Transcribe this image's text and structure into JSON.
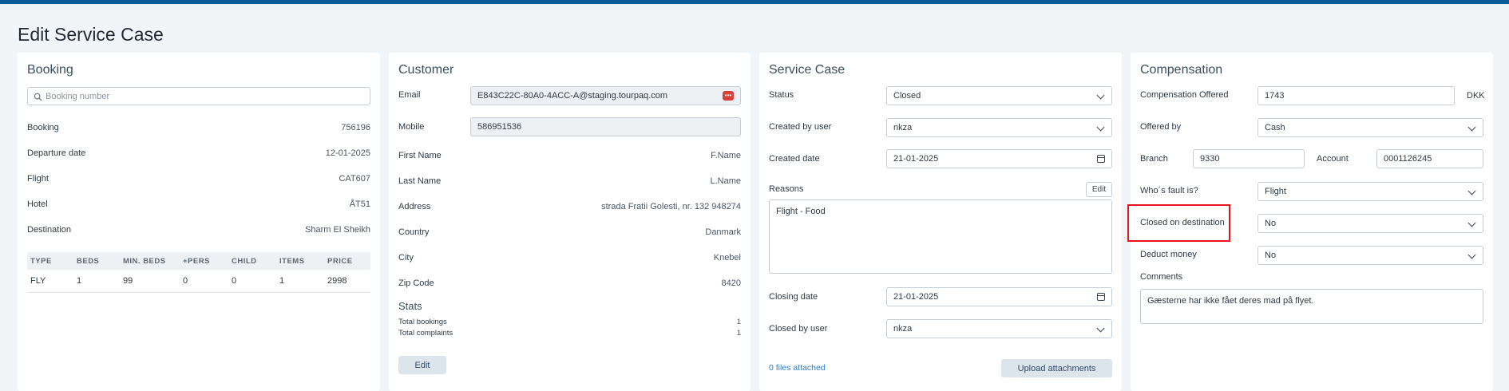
{
  "page": {
    "title": "Edit Service Case"
  },
  "booking": {
    "title": "Booking",
    "search_placeholder": "Booking number",
    "fields": [
      {
        "label": "Booking",
        "value": "756196"
      },
      {
        "label": "Departure date",
        "value": "12-01-2025"
      },
      {
        "label": "Flight",
        "value": "CAT607"
      },
      {
        "label": "Hotel",
        "value": "ÅT51"
      },
      {
        "label": "Destination",
        "value": "Sharm El Sheikh"
      }
    ],
    "table": {
      "headers": [
        "TYPE",
        "BEDS",
        "MIN. BEDS",
        "+PERS",
        "CHILD",
        "ITEMS",
        "PRICE"
      ],
      "rows": [
        [
          "FLY",
          "1",
          "99",
          "0",
          "0",
          "1",
          "2998"
        ]
      ]
    }
  },
  "customer": {
    "title": "Customer",
    "email_label": "Email",
    "email_value": "E843C22C-80A0-4ACC-A@staging.tourpaq.com",
    "mobile_label": "Mobile",
    "mobile_value": "586951536",
    "fields": [
      {
        "label": "First Name",
        "value": "F.Name"
      },
      {
        "label": "Last Name",
        "value": "L.Name"
      },
      {
        "label": "Address",
        "value": "strada Fratii Golesti, nr. 132 948274"
      },
      {
        "label": "Country",
        "value": "Danmark"
      },
      {
        "label": "City",
        "value": "Knebel"
      },
      {
        "label": "Zip Code",
        "value": "8420"
      }
    ],
    "stats_title": "Stats",
    "stats": [
      {
        "label": "Total bookings",
        "value": "1"
      },
      {
        "label": "Total complaints",
        "value": "1"
      }
    ],
    "edit_label": "Edit"
  },
  "service_case": {
    "title": "Service Case",
    "status_label": "Status",
    "status_value": "Closed",
    "created_by_label": "Created by user",
    "created_by_value": "nkza",
    "created_date_label": "Created date",
    "created_date_value": "21-01-2025",
    "reasons_label": "Reasons",
    "reasons_edit": "Edit",
    "reasons_text": "Flight - Food",
    "closing_date_label": "Closing date",
    "closing_date_value": "21-01-2025",
    "closed_by_label": "Closed by user",
    "closed_by_value": "nkza",
    "files_link": "0 files attached",
    "upload_label": "Upload attachments"
  },
  "compensation": {
    "title": "Compensation",
    "offered_label": "Compensation Offered",
    "offered_value": "1743",
    "currency": "DKK",
    "offered_by_label": "Offered by",
    "offered_by_value": "Cash",
    "branch_label": "Branch",
    "branch_value": "9330",
    "account_label": "Account",
    "account_value": "0001126245",
    "fault_label": "Who´s fault is?",
    "fault_value": "Flight",
    "closed_dest_label": "Closed on destination",
    "closed_dest_value": "No",
    "deduct_label": "Deduct money",
    "deduct_value": "No",
    "comments_label": "Comments",
    "comments_value": "Gæsterne har ikke fået deres mad på flyet."
  },
  "colors": {
    "topbar": "#0a5d94",
    "highlight": "#e8141c",
    "link": "#2a7bd3",
    "password_icon": "#d9403a"
  }
}
